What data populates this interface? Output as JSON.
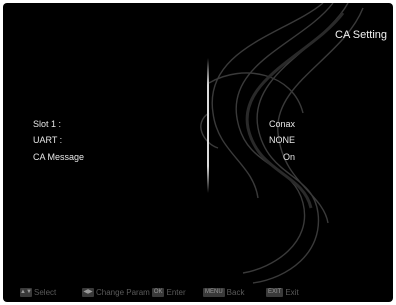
{
  "title": "CA Setting",
  "rows": [
    {
      "label": "Slot 1 :",
      "value": "Conax"
    },
    {
      "label": "UART :",
      "value": "NONE"
    },
    {
      "label": "CA Message",
      "value": "On"
    }
  ],
  "footer": {
    "select_key_icon": "up-down-arrow-icon",
    "select_label": "Select",
    "change_key_icon": "left-right-arrow-icon",
    "change_label": "Change Param",
    "ok_key": "OK",
    "enter_label": "Enter",
    "menu_key": "MENU",
    "back_label": "Back",
    "exit_key": "EXIT",
    "exit_label": "Exit"
  }
}
